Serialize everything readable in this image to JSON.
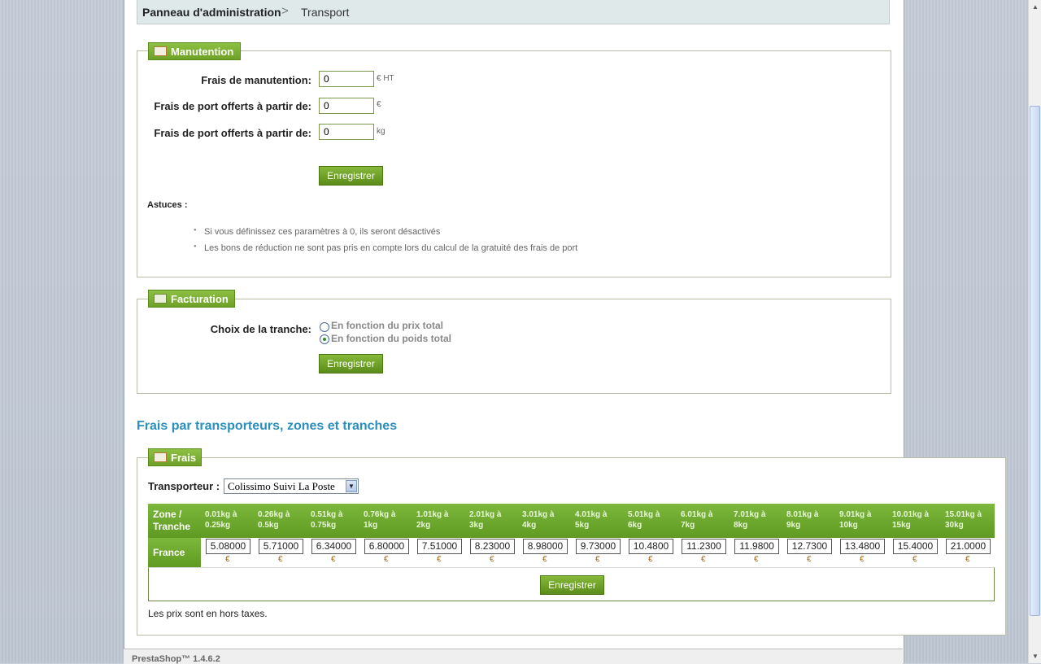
{
  "breadcrumb": {
    "root": "Panneau d'administration",
    "separator": ">",
    "current": "Transport"
  },
  "handling": {
    "legend": "Manutention",
    "fields": [
      {
        "label": "Frais de manutention:",
        "value": "0",
        "unit": "€ HT"
      },
      {
        "label": "Frais de port offerts à partir de:",
        "value": "0",
        "unit": "€"
      },
      {
        "label": "Frais de port offerts à partir de:",
        "value": "0",
        "unit": "kg"
      }
    ],
    "save": "Enregistrer",
    "tips_title": "Astuces :",
    "tips": [
      "Si vous définissez ces paramètres à 0, ils seront désactivés",
      "Les bons de réduction ne sont pas pris en compte lors du calcul de la gratuité des frais de port"
    ]
  },
  "billing": {
    "legend": "Facturation",
    "label": "Choix de la tranche:",
    "options": [
      "En fonction du prix total",
      "En fonction du poids total"
    ],
    "selected_index": 1,
    "save": "Enregistrer"
  },
  "section_title": "Frais par transporteurs, zones et tranches",
  "fees": {
    "legend": "Frais",
    "carrier_label": "Transporteur :",
    "carrier_value": "Colissimo Suivi La Poste",
    "zone_header_1": "Zone /",
    "zone_header_2": "Tranche",
    "ranges": [
      [
        "0.01kg à",
        "0.25kg"
      ],
      [
        "0.26kg à",
        "0.5kg"
      ],
      [
        "0.51kg à",
        "0.75kg"
      ],
      [
        "0.76kg à",
        "1kg"
      ],
      [
        "1.01kg à",
        "2kg"
      ],
      [
        "2.01kg à",
        "3kg"
      ],
      [
        "3.01kg à",
        "4kg"
      ],
      [
        "4.01kg à",
        "5kg"
      ],
      [
        "5.01kg à",
        "6kg"
      ],
      [
        "6.01kg à",
        "7kg"
      ],
      [
        "7.01kg à",
        "8kg"
      ],
      [
        "8.01kg à",
        "9kg"
      ],
      [
        "9.01kg à",
        "10kg"
      ],
      [
        "10.01kg à",
        "15kg"
      ],
      [
        "15.01kg à",
        "30kg"
      ]
    ],
    "zone": "France",
    "prices": [
      "5.08000",
      "5.71000",
      "6.34000",
      "6.80000",
      "7.51000",
      "8.23000",
      "8.98000",
      "9.73000",
      "10.4800",
      "11.2300",
      "11.9800",
      "12.7300",
      "13.4800",
      "15.4000",
      "21.0000"
    ],
    "currency": "€",
    "save": "Enregistrer",
    "note": "Les prix sont en hors taxes."
  },
  "footer": "PrestaShop™ 1.4.6.2"
}
